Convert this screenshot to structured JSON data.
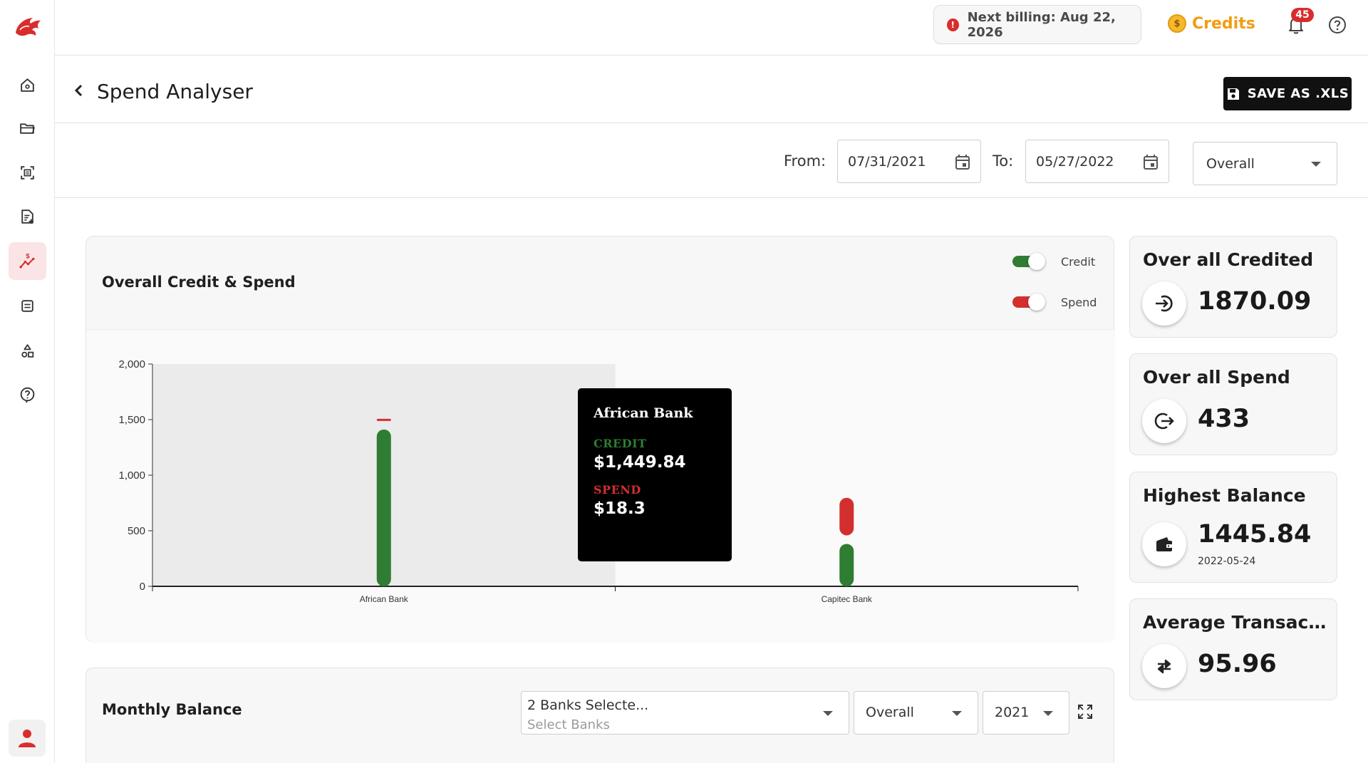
{
  "topbar": {
    "billing_text": "Next billing: Aug 22, 2026",
    "billing_icon": "info-icon",
    "credits_label": "Credits",
    "credits_icon": "coin-icon",
    "notification_count": "45",
    "accent_color": "#d92d2d",
    "credits_color": "#f39c12"
  },
  "sidebar": {
    "items": [
      {
        "name": "home-icon"
      },
      {
        "name": "folder-icon"
      },
      {
        "name": "scan-icon"
      },
      {
        "name": "document-add-icon"
      },
      {
        "name": "spend-analyser-icon",
        "active": true
      },
      {
        "name": "list-icon"
      },
      {
        "name": "shapes-icon"
      },
      {
        "name": "help-icon"
      }
    ],
    "user_icon": "user-icon"
  },
  "header": {
    "title": "Spend Analyser",
    "save_label": "SAVE AS .XLS"
  },
  "filters": {
    "from_label": "From:",
    "from_value": "07/31/2021",
    "to_label": "To:",
    "to_value": "05/27/2022",
    "period_value": "Overall"
  },
  "chart": {
    "title": "Overall Credit & Spend",
    "toggles": {
      "credit_label": "Credit",
      "spend_label": "Spend",
      "credit_color": "#2e7d32",
      "spend_color": "#d32f2f"
    },
    "tooltip": {
      "title": "African Bank",
      "credit_label": "CREDIT",
      "credit_value": "$1,449.84",
      "spend_label": "SPEND",
      "spend_value": "$18.3"
    }
  },
  "chart_data": {
    "type": "bar",
    "categories": [
      "African Bank",
      "Capitec Bank"
    ],
    "series": [
      {
        "name": "Credit",
        "values": [
          1449.84,
          420
        ],
        "color": "#2e7d32"
      },
      {
        "name": "Spend",
        "values": [
          18.3,
          414.7
        ],
        "color": "#d32f2f"
      }
    ],
    "stacked": true,
    "ylim": [
      0,
      2000
    ],
    "yticks": [
      "0",
      "500",
      "1,000",
      "1,500",
      "2,000"
    ],
    "ytick_values": [
      0,
      500,
      1000,
      1500,
      2000
    ],
    "highlighted_category": "African Bank"
  },
  "stats": [
    {
      "title": "Over all Credited",
      "value": "1870.09",
      "icon": "login-arrow-icon"
    },
    {
      "title": "Over all Spend",
      "value": "433",
      "icon": "logout-arrow-icon"
    },
    {
      "title": "Highest Balance",
      "value": "1445.84",
      "sub": "2022-05-24",
      "icon": "wallet-icon"
    },
    {
      "title": "Average Transacti...",
      "value": "95.96",
      "icon": "swap-arrows-icon"
    }
  ],
  "monthly": {
    "title": "Monthly Balance",
    "banks_value": "2 Banks Selecte...",
    "banks_placeholder": "Select Banks",
    "period_value": "Overall",
    "year_value": "2021"
  }
}
